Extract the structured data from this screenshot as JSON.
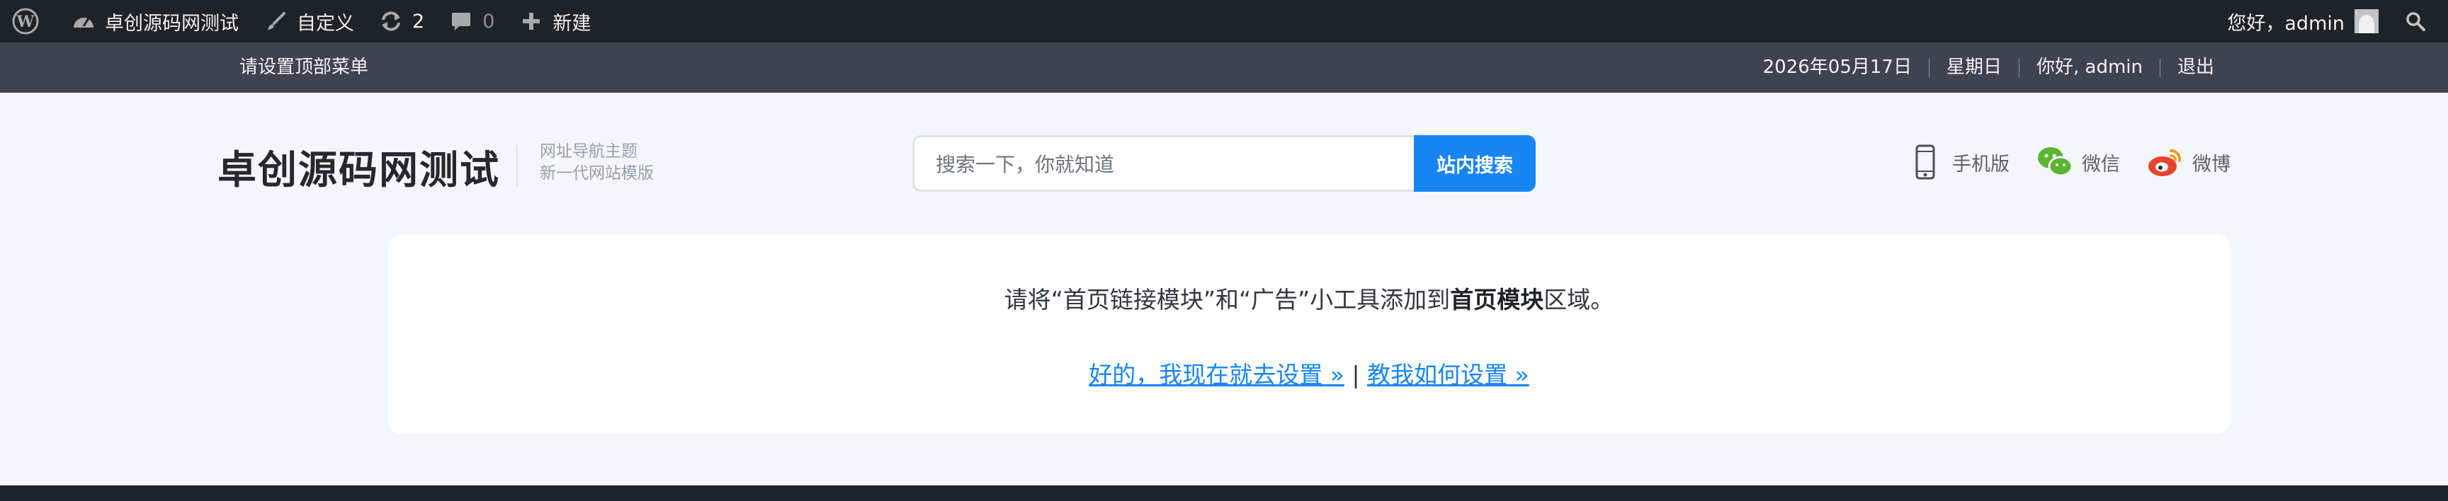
{
  "adminbar": {
    "site_name": "卓创源码网测试",
    "customize": "自定义",
    "updates_count": "2",
    "comments_count": "0",
    "new_label": "新建",
    "greeting": "您好，admin",
    "colors": {
      "bg": "#1d2327",
      "text": "#f0f0f1"
    }
  },
  "topbar": {
    "menu_hint": "请设置顶部菜单",
    "date": "2026年05月17日",
    "weekday": "星期日",
    "user": "你好, admin",
    "logout": "退出"
  },
  "header": {
    "logo": "卓创源码网测试",
    "tagline_line1": "网址导航主题",
    "tagline_line2": "新一代网站模版",
    "search_placeholder": "搜索一下，你就知道",
    "search_button": "站内搜索",
    "links": [
      {
        "label": "手机版",
        "icon": "mobile-icon"
      },
      {
        "label": "微信",
        "icon": "wechat-icon"
      },
      {
        "label": "微博",
        "icon": "weibo-icon"
      }
    ],
    "accent": "#1786f3"
  },
  "notice": {
    "text_before": "请将“首页链接模块”和“广告”小工具添加到",
    "text_bold": "首页模块",
    "text_after": "区域。",
    "link_setup": "好的，我现在就去设置 »",
    "divider": "|",
    "link_howto": "教我如何设置 »"
  }
}
